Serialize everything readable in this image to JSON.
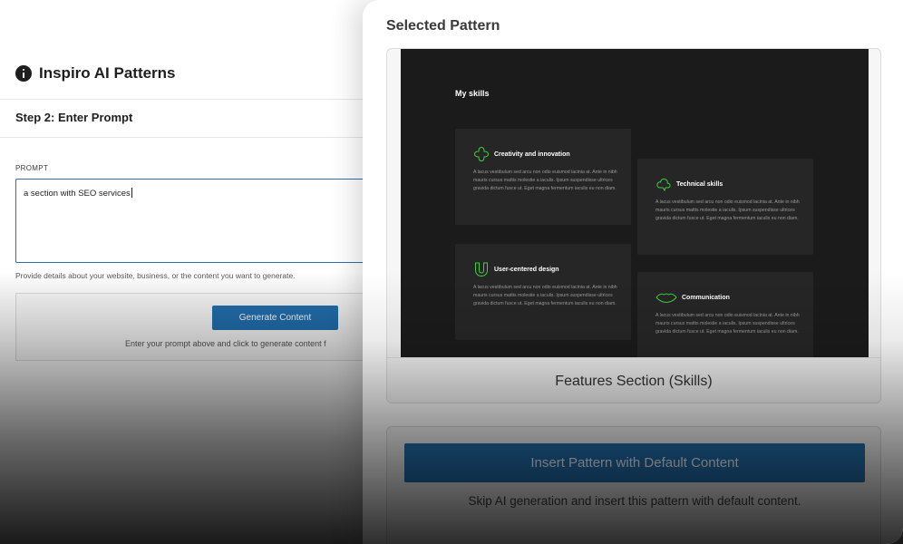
{
  "left_panel": {
    "title": "Inspiro AI Patterns",
    "title_icon": "info-icon",
    "step_title": "Step 2: Enter Prompt",
    "prompt_label": "PROMPT",
    "prompt_value": "a section with SEO services",
    "help_text": "Provide details about your website, business, or the content you want to generate.",
    "generate_button": "Generate Content",
    "generate_hint": "Enter your prompt above and click to generate content f"
  },
  "right_panel": {
    "heading": "Selected Pattern",
    "preview": {
      "section_title": "My skills",
      "cards": [
        {
          "title": "Creativity and innovation",
          "icon": "clover-icon",
          "text": "A lacus vestibulum sed arcu non odio euismod lacinia at. Ante in nibh mauris cursus mattis molestie a iaculis. Ipsum suspendisse ultrices gravida dictum fusce ut. Eget magna fermentum iaculis eu non diam."
        },
        {
          "title": "Technical skills",
          "icon": "cloud-icon",
          "text": "A lacus vestibulum sed arcu non odio euismod lacinia at. Ante in nibh mauris cursus mattis molestie a iaculis. Ipsum suspendisse ultrices gravida dictum fusce ut. Eget magna fermentum iaculis eu non diam."
        },
        {
          "title": "User-centered design",
          "icon": "magnet-icon",
          "text": "A lacus vestibulum sed arcu non odio euismod lacinia at. Ante in nibh mauris cursus mattis molestie a iaculis. Ipsum suspendisse ultrices gravida dictum fusce ut. Eget magna fermentum iaculis eu non diam."
        },
        {
          "title": "Communication",
          "icon": "lips-icon",
          "text": "A lacus vestibulum sed arcu non odio euismod lacinia at. Ante in nibh mauris cursus mattis molestie a iaculis. Ipsum suspendisse ultrices gravida dictum fusce ut. Eget magna fermentum iaculis eu non diam."
        }
      ]
    },
    "pattern_name": "Features Section (Skills)",
    "insert_button": "Insert Pattern with Default Content",
    "insert_hint": "Skip AI generation and insert this pattern with default content."
  },
  "colors": {
    "primary": "#2271b1",
    "accent_green": "#3ecf3e",
    "preview_bg": "#1b1b1b",
    "card_bg": "#262626"
  }
}
